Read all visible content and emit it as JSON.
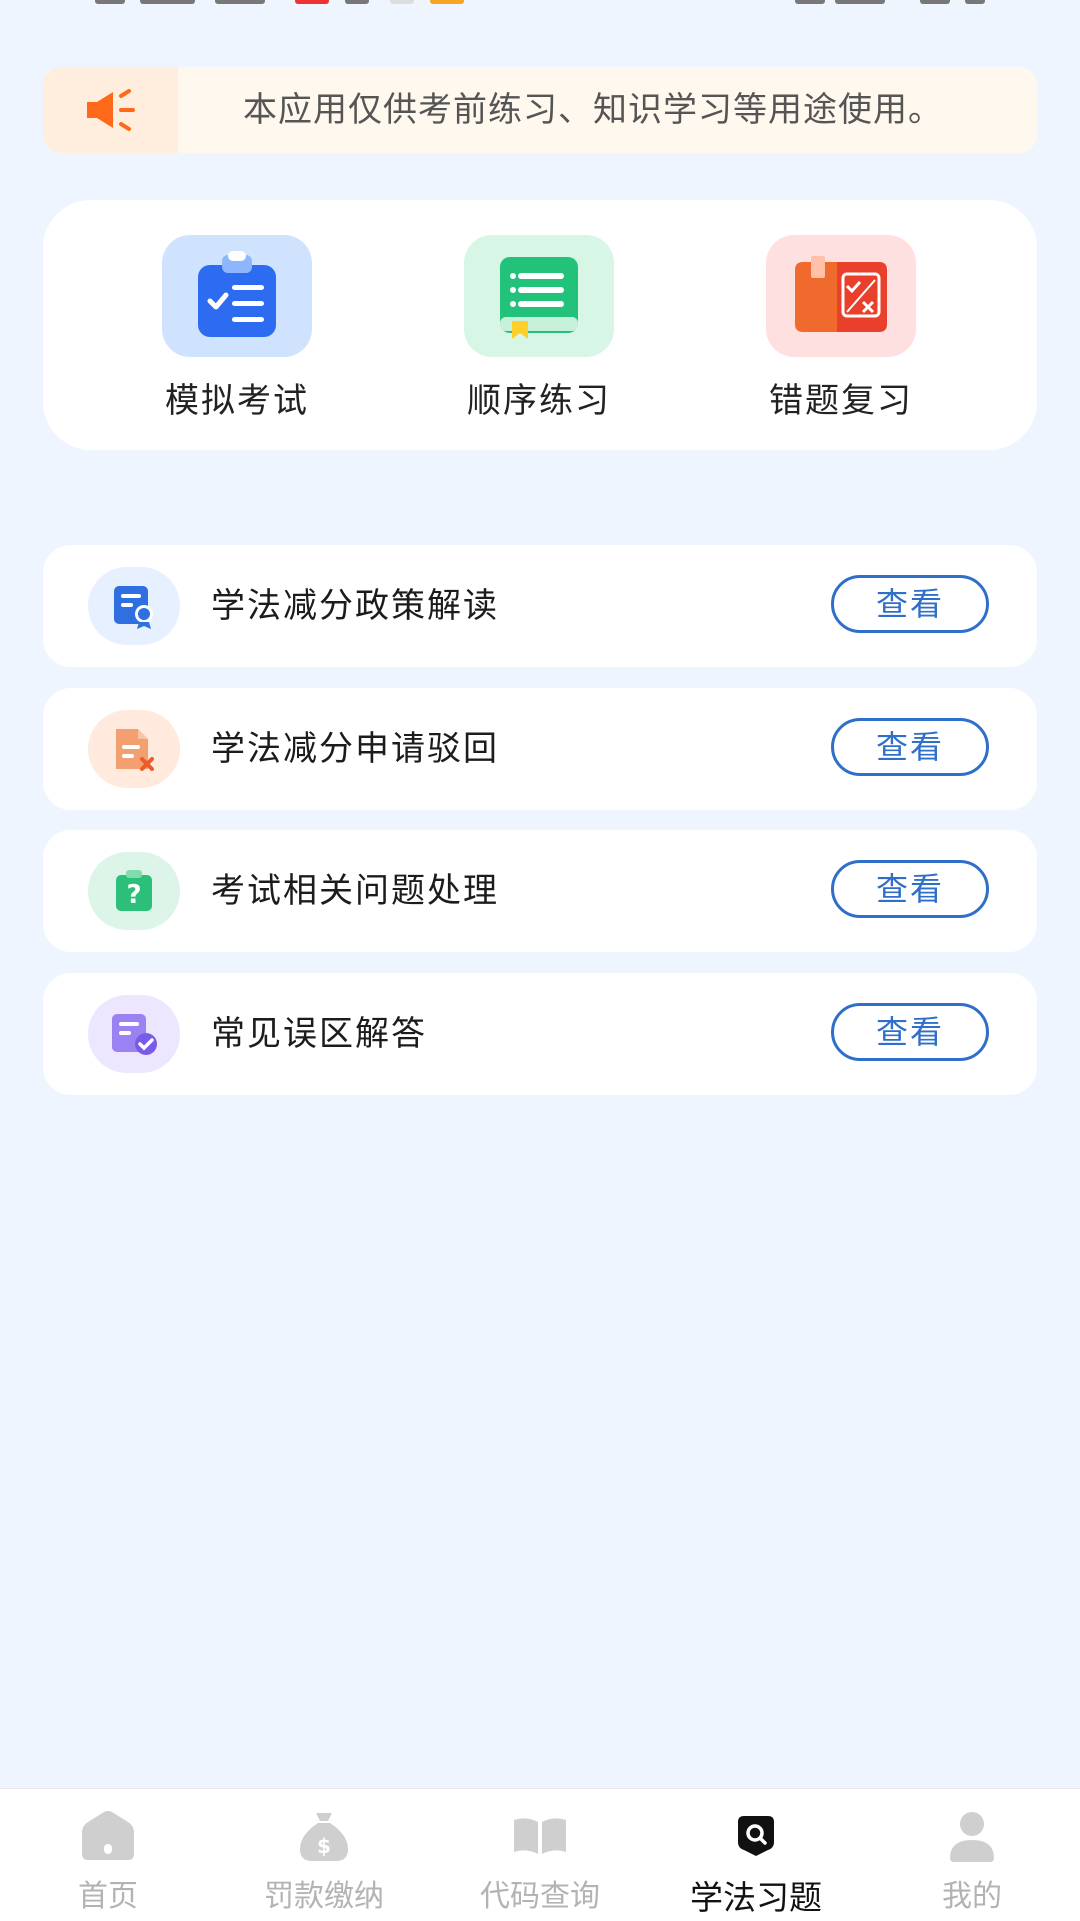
{
  "notice": {
    "text": "本应用仅供考前练习、知识学习等用途使用。"
  },
  "quick_actions": [
    {
      "label": "模拟考试",
      "icon": "clipboard-checklist-icon",
      "color": "#2d6cf0",
      "bg": "#cfe3ff"
    },
    {
      "label": "顺序练习",
      "icon": "book-list-icon",
      "color": "#23c27a",
      "bg": "#d8f6e6"
    },
    {
      "label": "错题复习",
      "icon": "wrong-answer-book-icon",
      "color": "#ef4a2e",
      "bg": "#ffe0e0"
    }
  ],
  "list_items": [
    {
      "title": "学法减分政策解读",
      "button": "查看",
      "icon": "document-award-icon",
      "color": "#2f6fe0",
      "bg": "#e6f0ff"
    },
    {
      "title": "学法减分申请驳回",
      "button": "查看",
      "icon": "document-reject-icon",
      "color": "#f08a4a",
      "bg": "#ffeadd"
    },
    {
      "title": "考试相关问题处理",
      "button": "查看",
      "icon": "question-bag-icon",
      "color": "#2cbf79",
      "bg": "#dcf5e8"
    },
    {
      "title": "常见误区解答",
      "button": "查看",
      "icon": "document-check-icon",
      "color": "#8b6cf0",
      "bg": "#ece6ff"
    }
  ],
  "tabbar": [
    {
      "label": "首页",
      "icon": "home-icon",
      "active": false
    },
    {
      "label": "罚款缴纳",
      "icon": "money-bag-icon",
      "active": false
    },
    {
      "label": "代码查询",
      "icon": "open-book-icon",
      "active": false
    },
    {
      "label": "学法习题",
      "icon": "search-shield-icon",
      "active": true
    },
    {
      "label": "我的",
      "icon": "user-icon",
      "active": false
    }
  ]
}
